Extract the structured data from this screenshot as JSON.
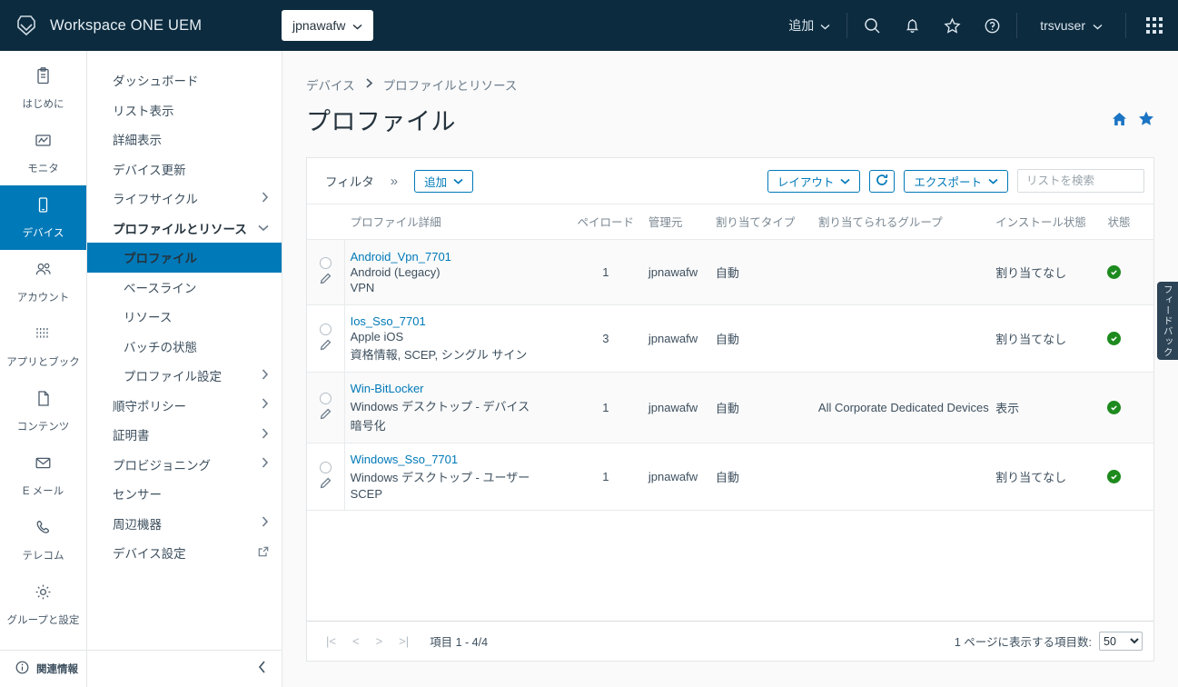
{
  "topbar": {
    "brand": "Workspace ONE UEM",
    "logo_icon": "workspace-one-logo",
    "org_selector": "jpnawafw",
    "add_menu": "追加",
    "icons": [
      "search-icon",
      "bell-icon",
      "star-icon",
      "help-icon"
    ],
    "user": "trsvuser",
    "app_grid_icon": "app-grid-icon"
  },
  "rail": {
    "items": [
      {
        "label": "はじめに",
        "icon": "clipboard-icon",
        "active": false
      },
      {
        "label": "モニタ",
        "icon": "monitor-chart-icon",
        "active": false
      },
      {
        "label": "デバイス",
        "icon": "device-phone-icon",
        "active": true
      },
      {
        "label": "アカウント",
        "icon": "accounts-people-icon",
        "active": false
      },
      {
        "label": "アプリとブック",
        "icon": "apps-grid-icon",
        "active": false
      },
      {
        "label": "コンテンツ",
        "icon": "content-file-icon",
        "active": false
      },
      {
        "label": "E メール",
        "icon": "email-envelope-icon",
        "active": false
      },
      {
        "label": "テレコム",
        "icon": "telecom-phone-icon",
        "active": false
      },
      {
        "label": "グループと設定",
        "icon": "gear-icon",
        "active": false
      }
    ],
    "footer": {
      "label": "関連情報",
      "icon": "info-circle-icon"
    }
  },
  "subnav": {
    "items": [
      {
        "label": "ダッシュボード",
        "chevron": "",
        "level": 0,
        "bold": false,
        "selected": false
      },
      {
        "label": "リスト表示",
        "chevron": "",
        "level": 0,
        "bold": false,
        "selected": false
      },
      {
        "label": "詳細表示",
        "chevron": "",
        "level": 0,
        "bold": false,
        "selected": false
      },
      {
        "label": "デバイス更新",
        "chevron": "",
        "level": 0,
        "bold": false,
        "selected": false
      },
      {
        "label": "ライフサイクル",
        "chevron": "chevron-right-icon",
        "level": 0,
        "bold": false,
        "selected": false
      },
      {
        "label": "プロファイルとリソース",
        "chevron": "chevron-down-icon",
        "level": 0,
        "bold": true,
        "selected": false
      },
      {
        "label": "プロファイル",
        "chevron": "",
        "level": 1,
        "bold": true,
        "selected": true
      },
      {
        "label": "ベースライン",
        "chevron": "",
        "level": 1,
        "bold": false,
        "selected": false
      },
      {
        "label": "リソース",
        "chevron": "",
        "level": 1,
        "bold": false,
        "selected": false
      },
      {
        "label": "バッチの状態",
        "chevron": "",
        "level": 1,
        "bold": false,
        "selected": false
      },
      {
        "label": "プロファイル設定",
        "chevron": "chevron-right-icon",
        "level": 1,
        "bold": false,
        "selected": false
      },
      {
        "label": "順守ポリシー",
        "chevron": "chevron-right-icon",
        "level": 0,
        "bold": false,
        "selected": false
      },
      {
        "label": "証明書",
        "chevron": "chevron-right-icon",
        "level": 0,
        "bold": false,
        "selected": false
      },
      {
        "label": "プロビジョニング",
        "chevron": "chevron-right-icon",
        "level": 0,
        "bold": false,
        "selected": false
      },
      {
        "label": "センサー",
        "chevron": "",
        "level": 0,
        "bold": false,
        "selected": false
      },
      {
        "label": "周辺機器",
        "chevron": "chevron-right-icon",
        "level": 0,
        "bold": false,
        "selected": false
      },
      {
        "label": "デバイス設定",
        "chevron": "external-link-icon",
        "level": 0,
        "bold": false,
        "selected": false
      }
    ],
    "collapse_icon": "chevron-left-icon"
  },
  "content": {
    "breadcrumb": [
      "デバイス",
      "プロファイルとリソース"
    ],
    "breadcrumb_separator": "chevron-right-icon",
    "page_title": "プロファイル",
    "title_actions": [
      "home-icon",
      "star-filled-icon"
    ]
  },
  "toolbar": {
    "filter_label": "フィルタ",
    "filter_expand_icon": "double-chevron-right-icon",
    "add_button": "追加",
    "layout_button": "レイアウト",
    "refresh_icon": "refresh-icon",
    "export_button": "エクスポート",
    "search_placeholder": "リストを検索",
    "search_value": ""
  },
  "table": {
    "columns": [
      "プロファイル詳細",
      "ペイロード",
      "管理元",
      "割り当てタイプ",
      "割り当てられるグループ",
      "インストール状態",
      "状態"
    ],
    "rows": [
      {
        "name": "Android_Vpn_7701",
        "platform": "Android (Legacy)",
        "payload_types": "VPN",
        "payload_count": "1",
        "managed_by": "jpnawafw",
        "assignment_type": "自動",
        "assigned_groups": "",
        "install_status": "割り当てなし",
        "install_status_link": false,
        "status_icon": "check-circle-green-icon"
      },
      {
        "name": "Ios_Sso_7701",
        "platform": "Apple iOS",
        "payload_types": "資格情報, SCEP, シングル サイン",
        "payload_count": "3",
        "managed_by": "jpnawafw",
        "assignment_type": "自動",
        "assigned_groups": "",
        "install_status": "割り当てなし",
        "install_status_link": false,
        "status_icon": "check-circle-green-icon"
      },
      {
        "name": "Win-BitLocker",
        "platform": "Windows デスクトップ - デバイス",
        "payload_types": "暗号化",
        "payload_count": "1",
        "managed_by": "jpnawafw",
        "assignment_type": "自動",
        "assigned_groups": "All Corporate Dedicated Devices",
        "install_status": "表示",
        "install_status_link": true,
        "status_icon": "check-circle-green-icon"
      },
      {
        "name": "Windows_Sso_7701",
        "platform": "Windows デスクトップ - ユーザー",
        "payload_types": "SCEP",
        "payload_count": "1",
        "managed_by": "jpnawafw",
        "assignment_type": "自動",
        "assigned_groups": "",
        "install_status": "割り当てなし",
        "install_status_link": false,
        "status_icon": "check-circle-green-icon"
      }
    ]
  },
  "pager": {
    "first_icon": "|<",
    "prev_icon": "<",
    "next_icon": ">",
    "last_icon": ">|",
    "range_text": "項目 1 - 4/4",
    "per_page_label": "1 ページに表示する項目数:",
    "per_page_value": "50"
  },
  "feedback_tab": {
    "label": "フィードバック",
    "icon": "double-chevron-left-icon"
  },
  "colors": {
    "header_bg": "#0c2b3f",
    "accent": "#0079b8",
    "status_green": "#1d8a1d",
    "page_bg": "#fafafa"
  }
}
